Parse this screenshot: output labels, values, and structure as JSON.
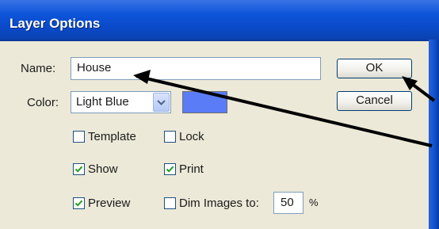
{
  "window": {
    "title": "Layer Options"
  },
  "form": {
    "name_label": "Name:",
    "name_value": "House",
    "color_label": "Color:",
    "color_selected": "Light Blue",
    "swatch_color": "#5b7cf7"
  },
  "buttons": {
    "ok": "OK",
    "cancel": "Cancel"
  },
  "checkboxes": {
    "template": {
      "label": "Template",
      "checked": false
    },
    "lock": {
      "label": "Lock",
      "checked": false
    },
    "show": {
      "label": "Show",
      "checked": true
    },
    "print": {
      "label": "Print",
      "checked": true
    },
    "preview": {
      "label": "Preview",
      "checked": true
    },
    "dim_images": {
      "label": "Dim Images to:",
      "checked": false
    }
  },
  "dim": {
    "value": "50",
    "unit": "%"
  }
}
